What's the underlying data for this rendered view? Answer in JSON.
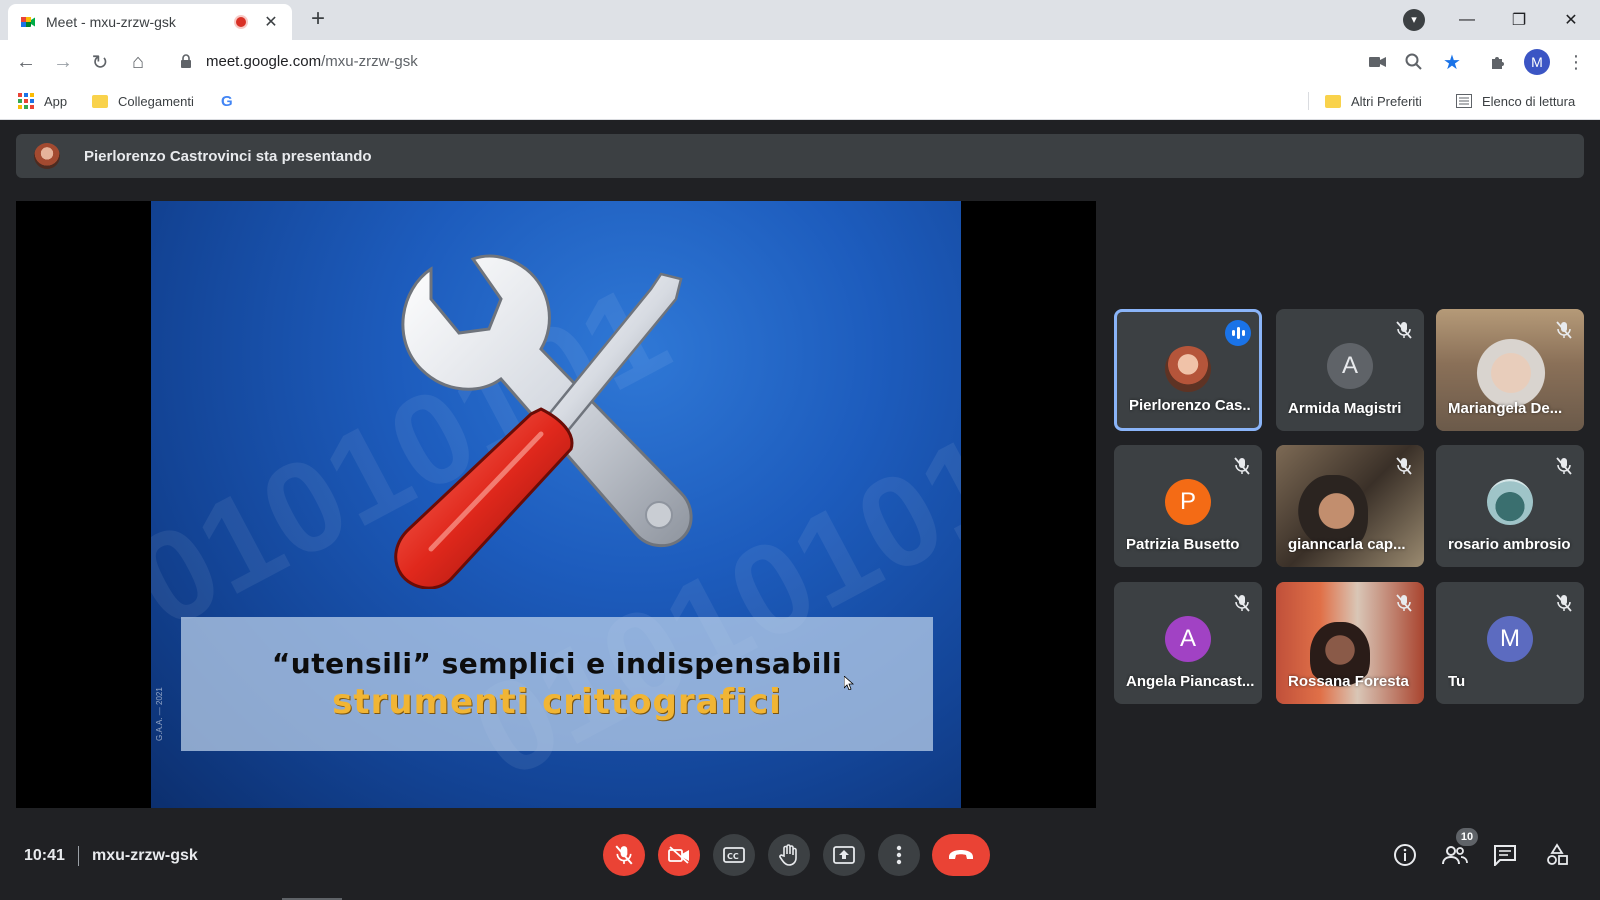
{
  "browser": {
    "tab_title": "Meet - mxu-zrzw-gsk",
    "url_host": "meet.google.com",
    "url_path": "/mxu-zrzw-gsk",
    "profile_initial": "M",
    "bookmarks": {
      "apps": "App",
      "links": "Collegamenti",
      "google": "G",
      "other": "Altri Preferiti",
      "reading_list": "Elenco di lettura"
    }
  },
  "meet": {
    "presenting_text": "Pierlorenzo Castrovinci sta presentando",
    "slide": {
      "line1": "“utensili” semplici e indispensabili",
      "line2": "strumenti crittografici",
      "credit": "G.A.A. — 2021",
      "background_digits": "01010101"
    },
    "participants": [
      {
        "name": "Pierlorenzo Cas...",
        "initial": "",
        "color": "#7a4030",
        "speaking": true
      },
      {
        "name": "Armida Magistri",
        "initial": "A",
        "color": "#3c4043",
        "speaking": false
      },
      {
        "name": "Mariangela De...",
        "initial": "",
        "color": "#6b5a4a",
        "speaking": false
      },
      {
        "name": "Patrizia Busetto",
        "initial": "P",
        "color": "#f46b15",
        "speaking": false
      },
      {
        "name": "gianncarla cap...",
        "initial": "",
        "color": "#5a4a3a",
        "speaking": false
      },
      {
        "name": "rosario ambrosio",
        "initial": "",
        "color": "#4a6a6a",
        "speaking": false
      },
      {
        "name": "Angela Piancast...",
        "initial": "A",
        "color": "#a142c4",
        "speaking": false
      },
      {
        "name": "Rossana Foresta",
        "initial": "",
        "color": "#a34a30",
        "speaking": false
      },
      {
        "name": "Tu",
        "initial": "M",
        "color": "#5c6bc0",
        "speaking": false
      }
    ],
    "clock": "10:41",
    "meeting_code": "mxu-zrzw-gsk",
    "people_count": "10"
  },
  "colors": {
    "danger": "#ea4335",
    "accent": "#8ab4f8",
    "surface": "#3c4043",
    "background": "#202124"
  }
}
